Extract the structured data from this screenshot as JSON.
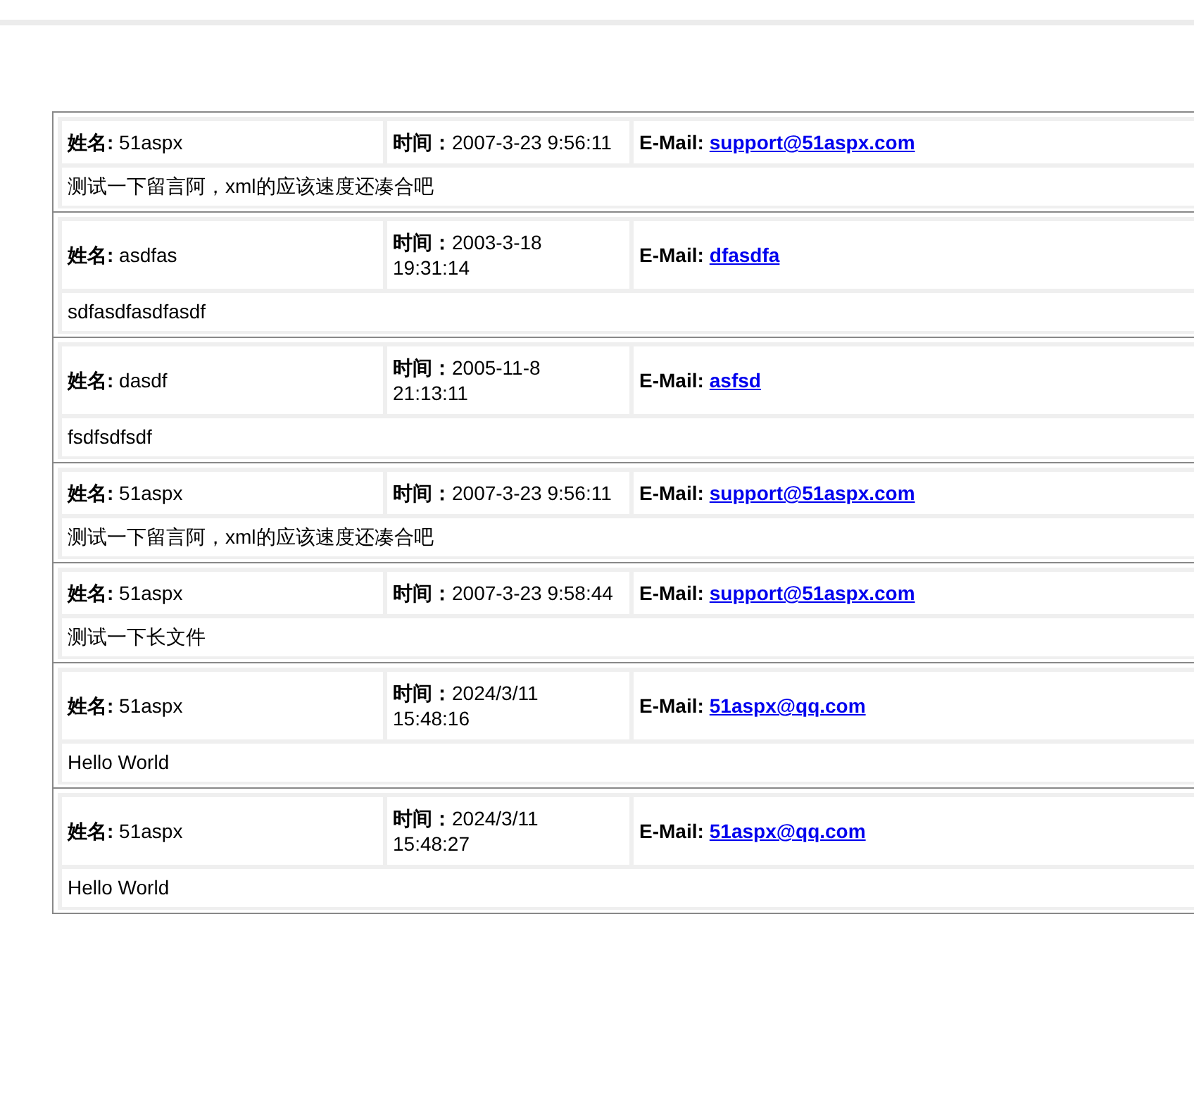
{
  "records": [
    {
      "name_label": "姓名:",
      "name": "51aspx",
      "time_label": "时间：",
      "time": "2007-3-23 9:56:11",
      "email_label": "E-Mail:",
      "email": "support@51aspx.com",
      "message": "测试一下留言阿，xml的应该速度还凑合吧"
    },
    {
      "name_label": "姓名:",
      "name": "asdfas",
      "time_label": "时间：",
      "time": "2003-3-18 19:31:14",
      "email_label": "E-Mail:",
      "email": "dfasdfa",
      "message": "sdfasdfasdfasdf"
    },
    {
      "name_label": "姓名:",
      "name": "dasdf",
      "time_label": "时间：",
      "time": "2005-11-8 21:13:11",
      "email_label": "E-Mail:",
      "email": "asfsd",
      "message": "fsdfsdfsdf"
    },
    {
      "name_label": "姓名:",
      "name": "51aspx",
      "time_label": "时间：",
      "time": "2007-3-23 9:56:11",
      "email_label": "E-Mail:",
      "email": "support@51aspx.com",
      "message": "测试一下留言阿，xml的应该速度还凑合吧"
    },
    {
      "name_label": "姓名:",
      "name": "51aspx",
      "time_label": "时间：",
      "time": "2007-3-23 9:58:44",
      "email_label": "E-Mail:",
      "email": "support@51aspx.com",
      "message": "测试一下长文件"
    },
    {
      "name_label": "姓名:",
      "name": "51aspx",
      "time_label": "时间：",
      "time": "2024/3/11 15:48:16",
      "email_label": "E-Mail:",
      "email": "51aspx@qq.com",
      "message": "Hello World"
    },
    {
      "name_label": "姓名:",
      "name": "51aspx",
      "time_label": "时间：",
      "time": "2024/3/11 15:48:27",
      "email_label": "E-Mail:",
      "email": "51aspx@qq.com",
      "message": "Hello World"
    }
  ]
}
